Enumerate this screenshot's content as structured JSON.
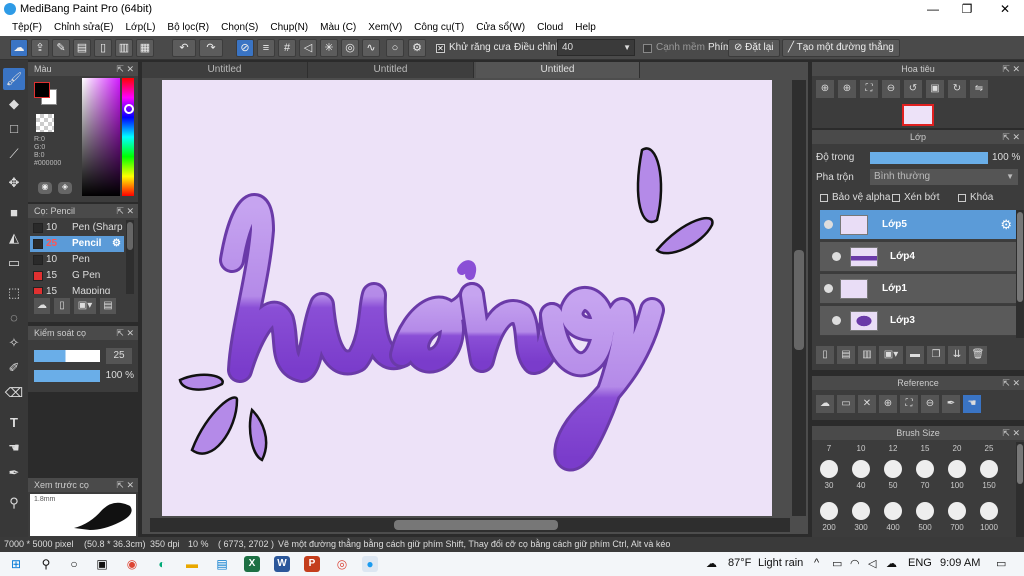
{
  "titlebar": {
    "title": "MediBang Paint Pro (64bit)",
    "minimize": "—",
    "maximize": "❐",
    "close": "✕"
  },
  "menu": [
    "Tệp(F)",
    "Chỉnh sửa(E)",
    "Lớp(L)",
    "Bộ lọc(R)",
    "Chọn(S)",
    "Chụp(N)",
    "Màu (C)",
    "Xem(V)",
    "Công cụ(T)",
    "Cửa sổ(W)",
    "Cloud",
    "Help"
  ],
  "toolbar": {
    "antialias_label": "Khử răng cưa",
    "adjust_label": "Điều chỉnh",
    "adjust_value": "40",
    "edge_label": "Cạnh mềm",
    "key_label": "Phím",
    "reset_label": "Đặt lại",
    "straight_label": "Tạo một đường thẳng"
  },
  "tabs": [
    "Untitled",
    "Untitled",
    "Untitled"
  ],
  "color_panel": {
    "title": "Màu",
    "r": "R:0",
    "g": "G:0",
    "b": "B:0",
    "hex": "#000000",
    "fg": "#000000",
    "bg": "#ffffff"
  },
  "brush_panel": {
    "title": "Cọ: Pencil",
    "items": [
      {
        "size": "10",
        "name": "Pen (Sharp",
        "color": "#2a2a2a"
      },
      {
        "size": "25",
        "name": "Pencil",
        "color": "#2a2a2a"
      },
      {
        "size": "10",
        "name": "Pen",
        "color": "#2a2a2a"
      },
      {
        "size": "15",
        "name": "G Pen",
        "color": "#e03030"
      },
      {
        "size": "15",
        "name": "Mapping Pe",
        "color": "#e03030"
      }
    ]
  },
  "brush_control": {
    "title": "Kiểm soát cọ",
    "size": "25",
    "opacity": "100 %"
  },
  "preview_panel": {
    "title": "Xem trước cọ",
    "size": "1.8mm"
  },
  "navigator": {
    "title": "Hoa tiêu"
  },
  "layers": {
    "title": "Lớp",
    "opacity_label": "Độ trong",
    "opacity_value": "100 %",
    "blend_label": "Pha trộn",
    "blend_value": "Bình thường",
    "protect_alpha": "Bảo vệ alpha",
    "clip": "Xén bớt",
    "lock": "Khóa",
    "items": [
      {
        "name": "Lớp5",
        "selected": true
      },
      {
        "name": "Lớp4",
        "selected": false
      },
      {
        "name": "Lớp1",
        "selected": false
      },
      {
        "name": "Lớp3",
        "selected": false
      }
    ]
  },
  "reference": {
    "title": "Reference"
  },
  "brush_size": {
    "title": "Brush Size",
    "top_row": [
      "7",
      "10",
      "12",
      "15",
      "20",
      "25"
    ],
    "row1": [
      "30",
      "40",
      "50",
      "70",
      "100",
      "150"
    ],
    "row2": [
      "200",
      "300",
      "400",
      "500",
      "700",
      "1000"
    ]
  },
  "status": {
    "canvas_size": "7000 * 5000 pixel",
    "dimensions": "(50.8 * 36.3cm)",
    "dpi": "350 dpi",
    "zoom": "10 %",
    "coords": "( 6773, 2702 )",
    "hint": "Vẽ một đường thẳng bằng cách giữ phím Shift, Thay đổi cỡ cọ bằng cách giữ phím Ctrl, Alt và kéo"
  },
  "taskbar": {
    "temp": "87°F",
    "weather": "Light rain",
    "lang": "ENG",
    "time": "9:09 AM"
  },
  "canvas": {
    "bg": "#ede2f8",
    "accent": "#a070e0"
  }
}
